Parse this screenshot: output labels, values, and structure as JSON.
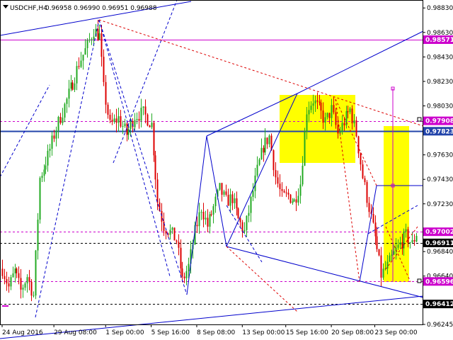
{
  "header": {
    "symbol_tf": "USDCHF,H4",
    "ohlc": "0.96958 0.96990 0.96951 0.96988"
  },
  "chart_data": {
    "type": "candlestick",
    "symbol": "USDCHF",
    "timeframe": "H4",
    "ylim": [
      0.96245,
      0.98895
    ],
    "y_ticks": [
      "0.98830",
      "0.98630",
      "0.98430",
      "0.98230",
      "0.98030",
      "0.97630",
      "0.97430",
      "0.97230",
      "0.96840",
      "0.96640",
      "0.96245"
    ],
    "x_ticks": [
      "24 Aug 2016",
      "29 Aug 08:00",
      "1 Sep 00:00",
      "5 Sep 16:00",
      "8 Sep 08:00",
      "13 Sep 00:00",
      "15 Sep 16:00",
      "20 Sep 08:00",
      "23 Sep 00:00"
    ],
    "x_range_bars": 200,
    "x_tick_bars": [
      0,
      25,
      50,
      72,
      94,
      116,
      137,
      159,
      180
    ],
    "level_labels": [
      {
        "value": "0.98571",
        "color": "#cc00cc"
      },
      {
        "value": "0.97908",
        "color": "#cc00cc"
      },
      {
        "value": "0.97823",
        "color": "#2244aa"
      },
      {
        "value": "0.97002",
        "color": "#cc00cc"
      },
      {
        "value": "0.96911",
        "color": "#000000"
      },
      {
        "value": "0.96596",
        "color": "#cc00cc"
      },
      {
        "value": "0.96412",
        "color": "#000000"
      }
    ],
    "colors": {
      "bull": "#22aa22",
      "bear": "#dd0000",
      "trend_blue": "#0000cc",
      "forecast_red": "#dd0000",
      "level_magenta": "#cc00cc",
      "zone_yellow": "#ffff00"
    },
    "price_path": [
      [
        0,
        0.967
      ],
      [
        3,
        0.9655
      ],
      [
        6,
        0.9668
      ],
      [
        9,
        0.9652
      ],
      [
        12,
        0.9664
      ],
      [
        15,
        0.9648
      ],
      [
        18,
        0.9744
      ],
      [
        22,
        0.9762
      ],
      [
        26,
        0.9785
      ],
      [
        30,
        0.9803
      ],
      [
        34,
        0.9822
      ],
      [
        37,
        0.9838
      ],
      [
        41,
        0.9852
      ],
      [
        44,
        0.9865
      ],
      [
        47,
        0.986
      ],
      [
        49,
        0.9817
      ],
      [
        52,
        0.9787
      ],
      [
        56,
        0.9793
      ],
      [
        60,
        0.978
      ],
      [
        64,
        0.9795
      ],
      [
        68,
        0.9797
      ],
      [
        72,
        0.9788
      ],
      [
        75,
        0.9725
      ],
      [
        78,
        0.9705
      ],
      [
        81,
        0.97
      ],
      [
        84,
        0.9693
      ],
      [
        87,
        0.966
      ],
      [
        90,
        0.9672
      ],
      [
        93,
        0.97
      ],
      [
        96,
        0.972
      ],
      [
        99,
        0.9705
      ],
      [
        102,
        0.972
      ],
      [
        105,
        0.9735
      ],
      [
        108,
        0.9725
      ],
      [
        111,
        0.9728
      ],
      [
        114,
        0.971
      ],
      [
        117,
        0.97
      ],
      [
        120,
        0.9725
      ],
      [
        123,
        0.975
      ],
      [
        126,
        0.977
      ],
      [
        129,
        0.9778
      ],
      [
        132,
        0.9745
      ],
      [
        135,
        0.9728
      ],
      [
        138,
        0.973
      ],
      [
        141,
        0.9725
      ],
      [
        144,
        0.974
      ],
      [
        147,
        0.98
      ],
      [
        150,
        0.9808
      ],
      [
        153,
        0.98
      ],
      [
        156,
        0.979
      ],
      [
        159,
        0.98
      ],
      [
        162,
        0.978
      ],
      [
        165,
        0.979
      ],
      [
        168,
        0.98
      ],
      [
        171,
        0.978
      ],
      [
        174,
        0.9745
      ],
      [
        177,
        0.972
      ],
      [
        180,
        0.9695
      ],
      [
        183,
        0.9665
      ],
      [
        186,
        0.9672
      ],
      [
        189,
        0.9682
      ],
      [
        192,
        0.969
      ],
      [
        195,
        0.9697
      ],
      [
        198,
        0.969
      ],
      [
        200,
        0.9699
      ]
    ]
  }
}
